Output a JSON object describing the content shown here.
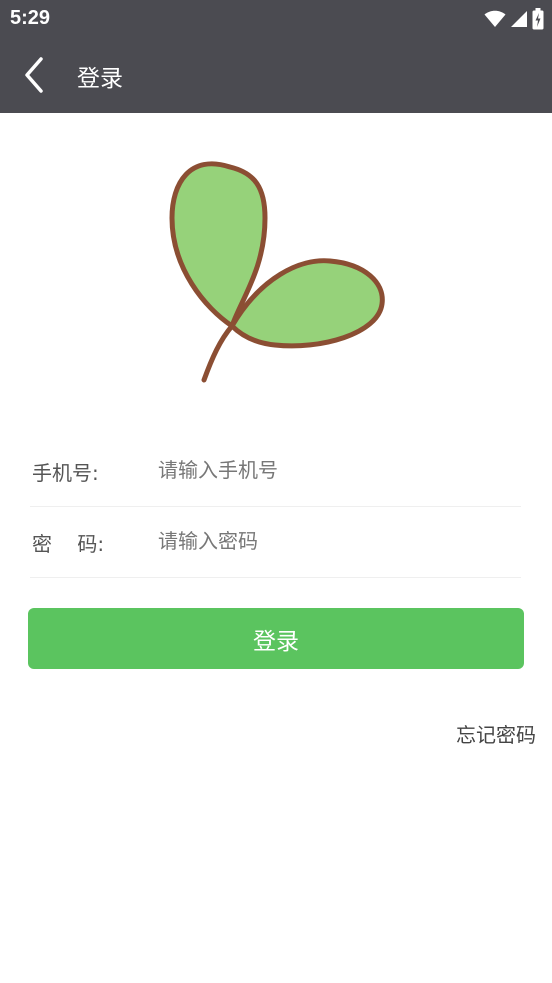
{
  "status_bar": {
    "time": "5:29",
    "icons": [
      "wifi-icon",
      "signal-icon",
      "battery-charging-icon"
    ]
  },
  "app_bar": {
    "back_icon": "chevron-left-icon",
    "title": "登录"
  },
  "logo": {
    "icon": "leaf-logo-icon",
    "leaf_color": "#96d27a",
    "outline_color": "#8b4e33"
  },
  "form": {
    "phone": {
      "label": "手机号:",
      "placeholder": "请输入手机号",
      "value": ""
    },
    "password": {
      "label": "密    码:",
      "placeholder": "请输入密码",
      "value": ""
    }
  },
  "actions": {
    "login_label": "登录",
    "forgot_label": "忘记密码"
  },
  "colors": {
    "header_bg": "#4b4b51",
    "accent": "#5bc45f",
    "page_bg": "#ffffff"
  }
}
